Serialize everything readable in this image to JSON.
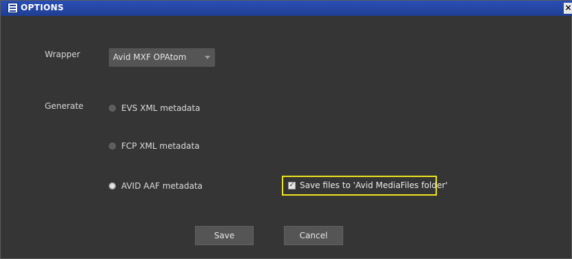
{
  "window": {
    "title": "OPTIONS",
    "close_symbol": "×"
  },
  "wrapper": {
    "label": "Wrapper",
    "selected": "Avid MXF OPAtom"
  },
  "generate": {
    "label": "Generate",
    "options": [
      {
        "label": "EVS XML metadata",
        "selected": false
      },
      {
        "label": "FCP XML metadata",
        "selected": false
      },
      {
        "label": "AVID AAF metadata",
        "selected": true
      }
    ]
  },
  "save_to_avid": {
    "label": "Save files to 'Avid MediaFiles folder'",
    "checked": true
  },
  "buttons": {
    "save": "Save",
    "cancel": "Cancel"
  }
}
